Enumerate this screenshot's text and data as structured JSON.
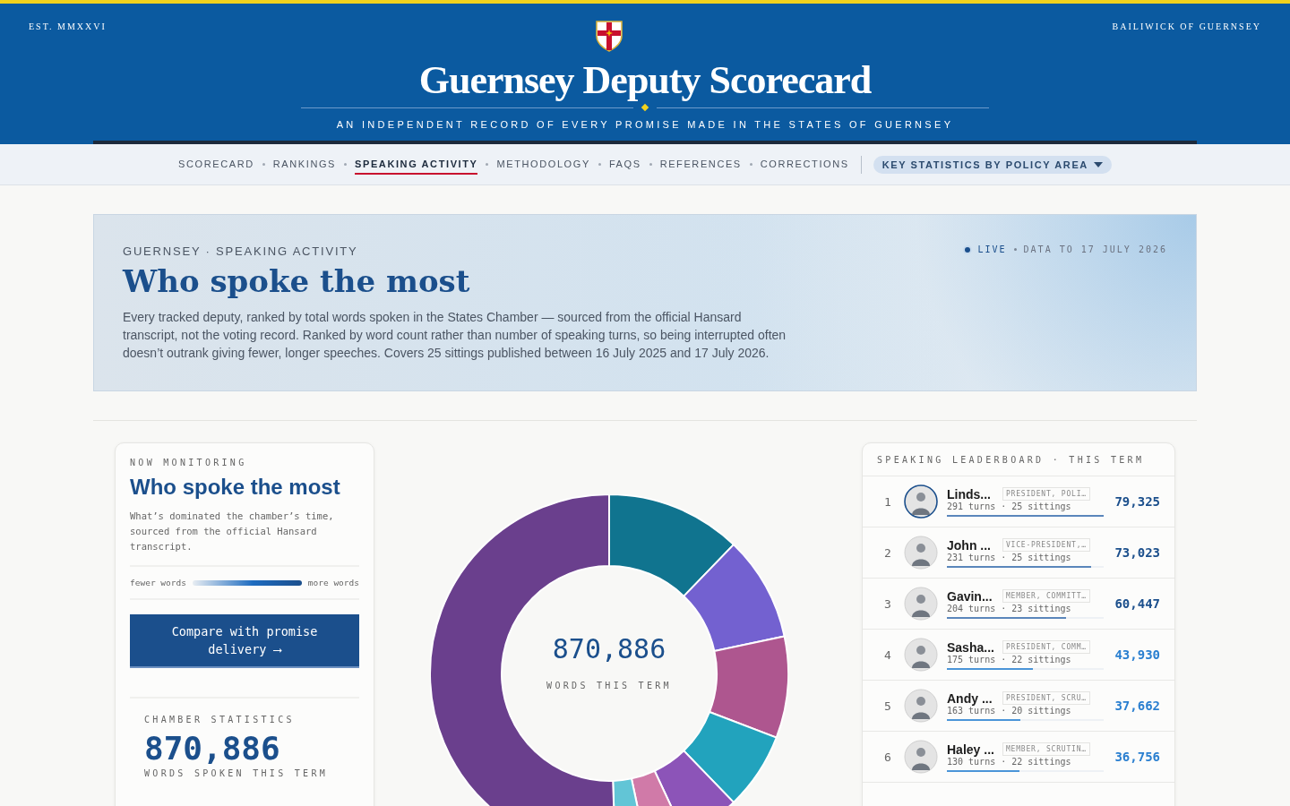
{
  "header": {
    "established": "EST. MMXXVI",
    "region": "BAILIWICK OF GUERNSEY",
    "title": "Guernsey Deputy Scorecard",
    "tagline": "AN INDEPENDENT RECORD OF EVERY PROMISE MADE IN THE STATES OF GUERNSEY"
  },
  "nav": {
    "items": [
      {
        "label": "SCORECARD",
        "selected": false
      },
      {
        "label": "RANKINGS",
        "selected": false
      },
      {
        "label": "SPEAKING ACTIVITY",
        "selected": true
      },
      {
        "label": "METHODOLOGY",
        "selected": false
      },
      {
        "label": "FAQS",
        "selected": false
      },
      {
        "label": "REFERENCES",
        "selected": false
      },
      {
        "label": "CORRECTIONS",
        "selected": false
      }
    ],
    "dropdown": "KEY STATISTICS BY POLICY AREA"
  },
  "hero": {
    "eyebrow": "GUERNSEY · SPEAKING ACTIVITY",
    "title": "Who spoke the most",
    "description": "Every tracked deputy, ranked by total words spoken in the States Chamber — sourced from the official Hansard transcript, not the voting record. Ranked by word count rather than number of speaking turns, so being interrupted often doesn’t outrank giving fewer, longer speeches. Covers 25 sittings published between 16 July 2025 and 17 July 2026.",
    "live": "LIVE",
    "data_date": "DATA TO 17 JULY 2026"
  },
  "sidebar": {
    "eyebrow": "NOW MONITORING",
    "title": "Who spoke the most",
    "description": "What’s dominated the chamber’s time, sourced from the official Hansard transcript.",
    "legend_low": "fewer words",
    "legend_high": "more words",
    "button": "Compare with promise delivery ⟶",
    "stats_label": "CHAMBER STATISTICS",
    "stats_value": "870,886",
    "stats_caption": "WORDS SPOKEN THIS TERM"
  },
  "donut": {
    "total": "870,886",
    "caption": "WORDS THIS TERM"
  },
  "leaderboard": {
    "title": "SPEAKING LEADERBOARD · THIS TERM",
    "rows": [
      {
        "rank": "1",
        "name": "Linds...",
        "role": "PRESIDENT, POLI…",
        "activity": "291 turns · 25 sittings",
        "words": "79,325",
        "level": 1.0,
        "selected": true
      },
      {
        "rank": "2",
        "name": "John ...",
        "role": "VICE-PRESIDENT,…",
        "activity": "231 turns · 25 sittings",
        "words": "73,023",
        "level": 0.92,
        "selected": false
      },
      {
        "rank": "3",
        "name": "Gavin...",
        "role": "MEMBER, COMMITT…",
        "activity": "204 turns · 23 sittings",
        "words": "60,447",
        "level": 0.76,
        "selected": false
      },
      {
        "rank": "4",
        "name": "Sasha...",
        "role": "PRESIDENT, COMM…",
        "activity": "175 turns · 22 sittings",
        "words": "43,930",
        "level": 0.55,
        "selected": false
      },
      {
        "rank": "5",
        "name": "Andy ...",
        "role": "PRESIDENT, SCRU…",
        "activity": "163 turns · 20 sittings",
        "words": "37,662",
        "level": 0.47,
        "selected": false
      },
      {
        "rank": "6",
        "name": "Haley ...",
        "role": "MEMBER, SCRUTIN…",
        "activity": "130 turns · 22 sittings",
        "words": "36,756",
        "level": 0.46,
        "selected": false
      }
    ]
  }
}
